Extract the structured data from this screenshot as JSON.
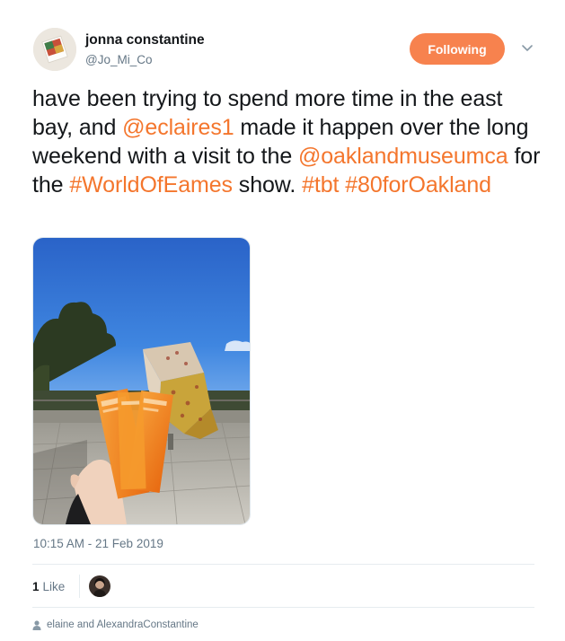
{
  "author": {
    "name": "jonna constantine",
    "handle": "@Jo_Mi_Co"
  },
  "follow_button": {
    "label": "Following",
    "color": "#f7824e"
  },
  "tweet": {
    "segments": [
      {
        "type": "text",
        "value": "have been trying to spend more time in the east bay, and "
      },
      {
        "type": "mention",
        "value": "@eclaires1"
      },
      {
        "type": "text",
        "value": " made it happen over the long weekend with a visit to the "
      },
      {
        "type": "mention",
        "value": "@oaklandmuseumca"
      },
      {
        "type": "text",
        "value": " for the "
      },
      {
        "type": "hashtag",
        "value": "#WorldOfEames"
      },
      {
        "type": "text",
        "value": " show. "
      },
      {
        "type": "hashtag",
        "value": "#tbt"
      },
      {
        "type": "text",
        "value": " "
      },
      {
        "type": "hashtag",
        "value": "#80forOakland"
      }
    ],
    "link_color": "#f4762d"
  },
  "timestamp": "10:15 AM - 21 Feb 2019",
  "likes": {
    "count": "1",
    "label": "Like"
  },
  "context": {
    "text": "elaine and AlexandraConstantine",
    "icon": "person-icon"
  }
}
